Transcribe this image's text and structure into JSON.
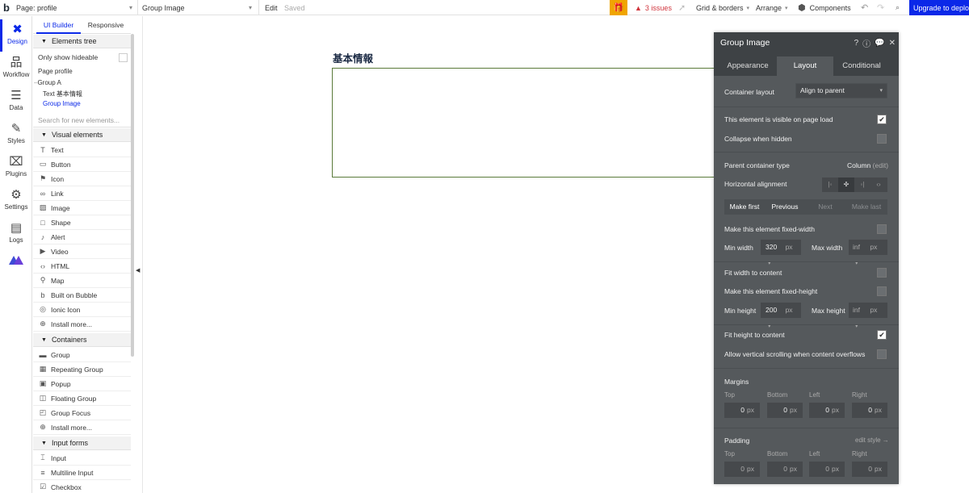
{
  "topbar": {
    "logo": "b",
    "page_label": "Page: profile",
    "element_label": "Group Image",
    "edit": "Edit",
    "saved": "Saved",
    "issues": "3 issues",
    "grid": "Grid & borders",
    "arrange": "Arrange",
    "components": "Components",
    "upgrade": "Upgrade to deploy"
  },
  "nav": [
    {
      "label": "Design",
      "icon": "design-icon"
    },
    {
      "label": "Workflow",
      "icon": "workflow-icon"
    },
    {
      "label": "Data",
      "icon": "data-icon"
    },
    {
      "label": "Styles",
      "icon": "styles-icon"
    },
    {
      "label": "Plugins",
      "icon": "plugins-icon"
    },
    {
      "label": "Settings",
      "icon": "settings-icon"
    },
    {
      "label": "Logs",
      "icon": "logs-icon"
    }
  ],
  "palette": {
    "tabs": [
      "UI Builder",
      "Responsive"
    ],
    "elements_tree": "Elements tree",
    "only_show_hideable": "Only show hideable",
    "tree": [
      "Page profile",
      "Group A",
      "Text 基本情報",
      "Group Image"
    ],
    "search_placeholder": "Search for new elements...",
    "visual_elements": "Visual elements",
    "visual": [
      "Text",
      "Button",
      "Icon",
      "Link",
      "Image",
      "Shape",
      "Alert",
      "Video",
      "HTML",
      "Map",
      "Built on Bubble",
      "Ionic Icon",
      "Install more..."
    ],
    "containers": "Containers",
    "container_items": [
      "Group",
      "Repeating Group",
      "Popup",
      "Floating Group",
      "Group Focus",
      "Install more..."
    ],
    "input_forms": "Input forms",
    "input_items": [
      "Input",
      "Multiline Input",
      "Checkbox"
    ]
  },
  "canvas": {
    "heading": "基本情報"
  },
  "panel": {
    "title": "Group Image",
    "tabs": [
      "Appearance",
      "Layout",
      "Conditional"
    ],
    "container_layout_label": "Container layout",
    "container_layout_value": "Align to parent",
    "visible_label": "This element is visible on page load",
    "collapse_label": "Collapse when hidden",
    "parent_type_label": "Parent container type",
    "parent_type_value": "Column",
    "parent_type_edit": "(edit)",
    "halign_label": "Horizontal alignment",
    "order_buttons": [
      "Make first",
      "Previous",
      "Next",
      "Make last"
    ],
    "fixed_width_label": "Make this element fixed-width",
    "min_width_label": "Min width",
    "min_width_value": "320",
    "max_width_label": "Max width",
    "max_width_value": "inf",
    "unit": "px",
    "fit_width_label": "Fit width to content",
    "fixed_height_label": "Make this element fixed-height",
    "min_height_label": "Min height",
    "min_height_value": "200",
    "max_height_label": "Max height",
    "max_height_value": "inf",
    "fit_height_label": "Fit height to content",
    "vscroll_label": "Allow vertical scrolling when content overflows",
    "margins_label": "Margins",
    "padding_label": "Padding",
    "edit_style": "edit style →",
    "sides": [
      "Top",
      "Bottom",
      "Left",
      "Right"
    ],
    "margins": [
      "0",
      "0",
      "0",
      "0"
    ],
    "paddings": [
      "0",
      "0",
      "0",
      "0"
    ]
  }
}
